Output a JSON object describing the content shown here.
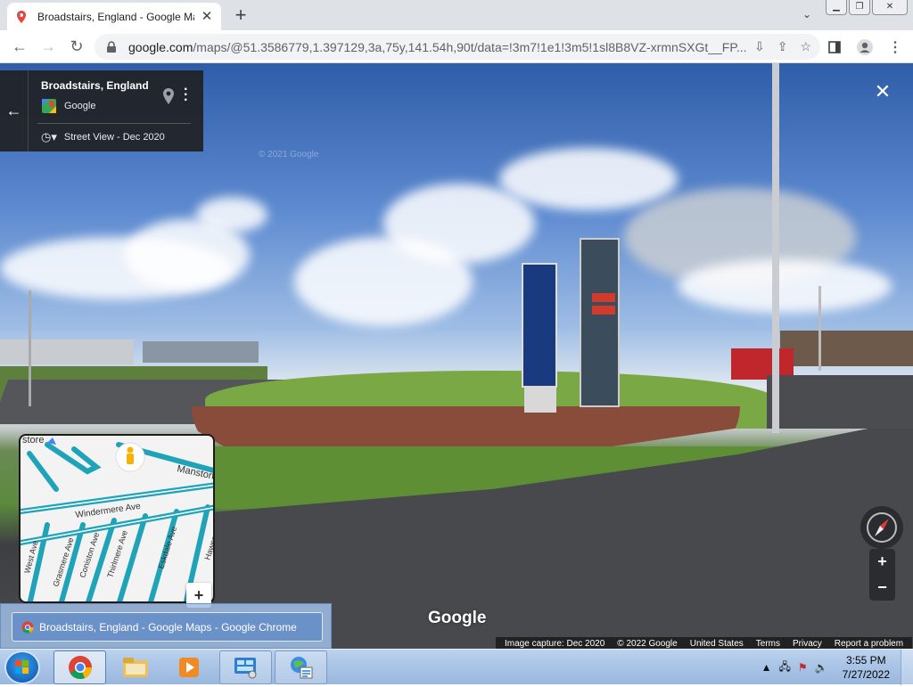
{
  "browser": {
    "tab_title": "Broadstairs, England - Google Maps",
    "new_tab_label": "+",
    "url_domain": "google.com",
    "url_rest": "/maps/@51.3586779,1.397129,3a,75y,141.54h,90t/data=!3m7!1e1!3m5!1sl8B8VZ-xrmnSXGt__FP..."
  },
  "streetview": {
    "place_name": "Broadstairs, England",
    "provider": "Google",
    "sv_date": "Street View - Dec 2020",
    "watermark": "© 2021 Google",
    "google_logo": "Google",
    "minimap_labels": {
      "store": "store",
      "manston": "Manston",
      "windermere": "Windermere Ave",
      "west": "West Ave",
      "grasmere": "Grasmere Ave",
      "coniston": "Coniston Ave",
      "thirlmere": "Thirlmere Ave",
      "eskdale": "Eskdale Ave",
      "hawes": "Hawes"
    },
    "footer": {
      "capture": "Image capture: Dec 2020",
      "copyright": "© 2022 Google",
      "country": "United States",
      "terms": "Terms",
      "privacy": "Privacy",
      "report": "Report a problem"
    },
    "zoom_in": "+",
    "zoom_out": "−",
    "minimap_expand": "+"
  },
  "taskbar": {
    "thumbnail_title": "Broadstairs, England - Google Maps - Google Chrome",
    "time": "3:55 PM",
    "date": "7/27/2022"
  },
  "colors": {
    "accent_map_roads": "#1fa3b8",
    "sky": "#5d8ad0",
    "grass": "#6c9a3c"
  }
}
